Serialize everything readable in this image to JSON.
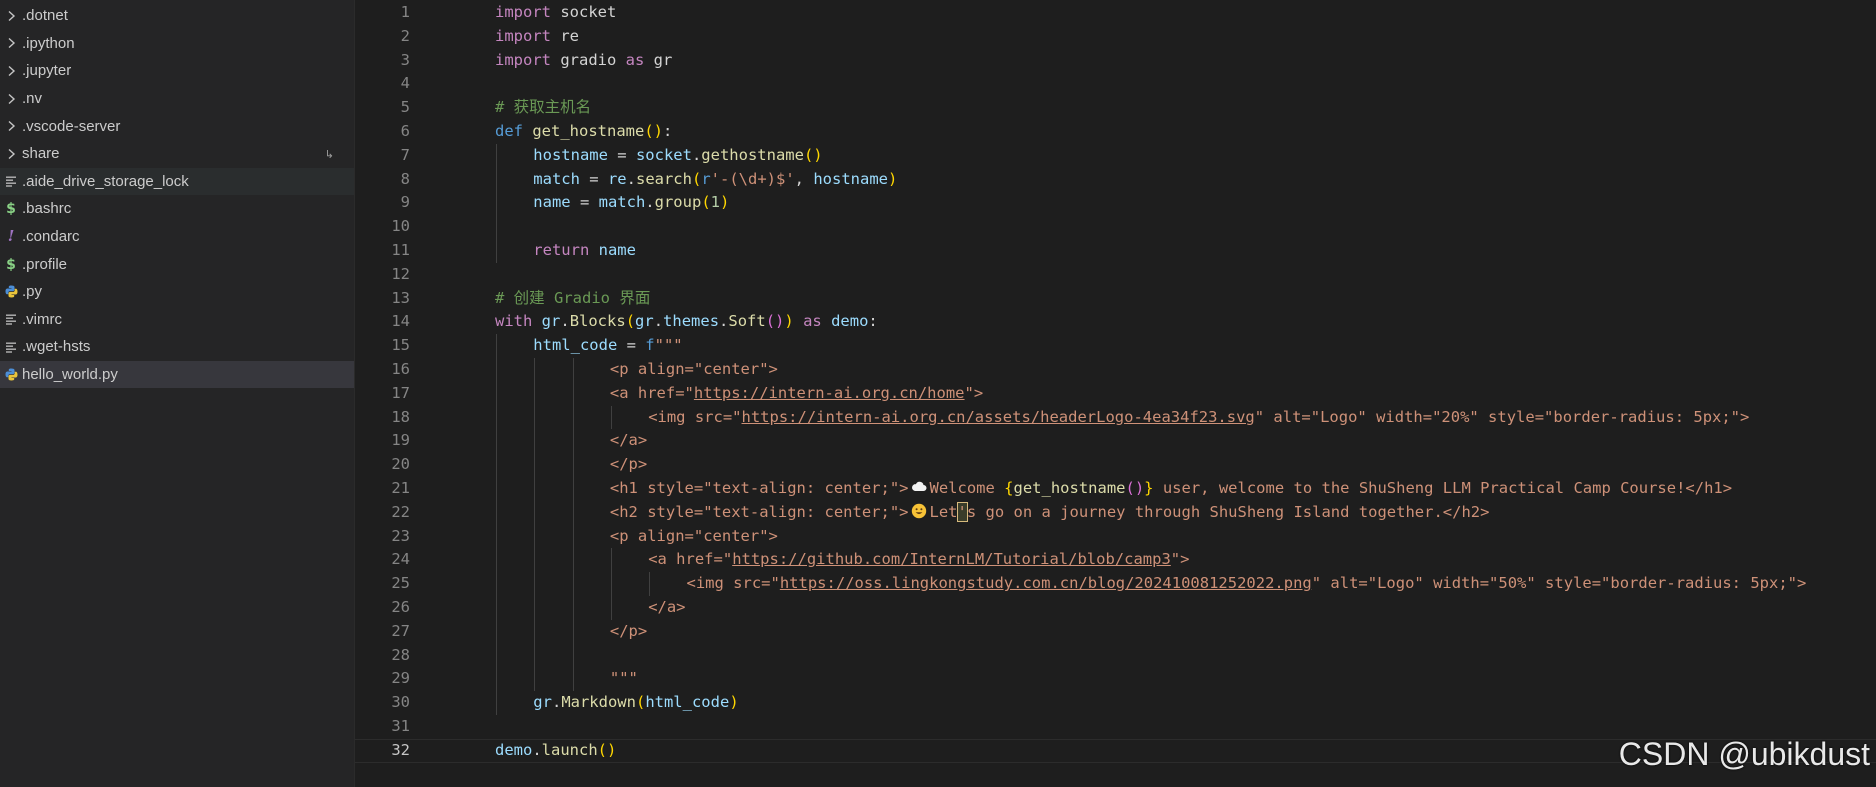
{
  "explorer": {
    "items": [
      {
        "label": ".dotnet",
        "kind": "folder",
        "icon": "chevron-right-icon"
      },
      {
        "label": ".ipython",
        "kind": "folder",
        "icon": "chevron-right-icon"
      },
      {
        "label": ".jupyter",
        "kind": "folder",
        "icon": "chevron-right-icon"
      },
      {
        "label": ".nv",
        "kind": "folder",
        "icon": "chevron-right-icon"
      },
      {
        "label": ".vscode-server",
        "kind": "folder",
        "icon": "chevron-right-icon"
      },
      {
        "label": "share",
        "kind": "folder",
        "icon": "chevron-right-icon",
        "symlink": true
      },
      {
        "label": ".aide_drive_storage_lock",
        "kind": "file",
        "icon": "lines-file-icon",
        "state": "hover"
      },
      {
        "label": ".bashrc",
        "kind": "file",
        "icon": "dollar-icon"
      },
      {
        "label": ".condarc",
        "kind": "file",
        "icon": "exclamation-icon"
      },
      {
        "label": ".profile",
        "kind": "file",
        "icon": "dollar-icon"
      },
      {
        "label": ".py",
        "kind": "file",
        "icon": "python-icon"
      },
      {
        "label": ".vimrc",
        "kind": "file",
        "icon": "lines-file-icon"
      },
      {
        "label": ".wget-hsts",
        "kind": "file",
        "icon": "lines-file-icon"
      },
      {
        "label": "hello_world.py",
        "kind": "file",
        "icon": "python-icon",
        "state": "selected"
      }
    ]
  },
  "editor": {
    "current_line": 32,
    "line_numbers": [
      "1",
      "2",
      "3",
      "4",
      "5",
      "6",
      "7",
      "8",
      "9",
      "10",
      "11",
      "12",
      "13",
      "14",
      "15",
      "16",
      "17",
      "18",
      "19",
      "20",
      "21",
      "22",
      "23",
      "24",
      "25",
      "26",
      "27",
      "28",
      "29",
      "30",
      "31",
      "32"
    ],
    "lines": [
      [
        [
          "kw",
          "import"
        ],
        [
          "",
          "socket"
        ]
      ],
      [
        [
          "kw",
          "import"
        ],
        [
          "",
          "re"
        ]
      ],
      [
        [
          "kw",
          "import"
        ],
        [
          "",
          "gradio "
        ],
        [
          "kw",
          "as"
        ],
        [
          "",
          " gr"
        ]
      ],
      [],
      [
        [
          "cm",
          "# 获取主机名"
        ]
      ],
      [
        [
          "kd",
          "def"
        ],
        [
          "",
          " "
        ],
        [
          "fn",
          "get_hostname"
        ],
        [
          "b1",
          "()"
        ],
        [
          "",
          ":"
        ]
      ],
      [
        [
          "",
          ""
        ],
        [
          "var",
          "hostname"
        ],
        [
          "",
          " = "
        ],
        [
          "var",
          "socket"
        ],
        [
          "",
          "."
        ],
        [
          "fn",
          "gethostname"
        ],
        [
          "b1",
          "()"
        ]
      ],
      [
        [
          "",
          ""
        ],
        [
          "var",
          "match"
        ],
        [
          "",
          " = "
        ],
        [
          "var",
          "re"
        ],
        [
          "",
          "."
        ],
        [
          "fn",
          "search"
        ],
        [
          "b1",
          "("
        ],
        [
          "kd",
          "r"
        ],
        [
          "st",
          "'-(\\d+)$'"
        ],
        [
          "",
          ", "
        ],
        [
          "var",
          "hostname"
        ],
        [
          "b1",
          ")"
        ]
      ],
      [
        [
          "",
          ""
        ],
        [
          "var",
          "name"
        ],
        [
          "",
          " = "
        ],
        [
          "var",
          "match"
        ],
        [
          "",
          "."
        ],
        [
          "fn",
          "group"
        ],
        [
          "b1",
          "("
        ],
        [
          "num",
          "1"
        ],
        [
          "b1",
          ")"
        ]
      ],
      [],
      [
        [
          "",
          ""
        ],
        [
          "kw",
          "return"
        ],
        [
          "",
          " "
        ],
        [
          "var",
          "name"
        ]
      ],
      [],
      [
        [
          "cm",
          "# 创建 Gradio 界面"
        ]
      ],
      [
        [
          "kw",
          "with"
        ],
        [
          "",
          " "
        ],
        [
          "var",
          "gr"
        ],
        [
          "",
          "."
        ],
        [
          "fn",
          "Blocks"
        ],
        [
          "b1",
          "("
        ],
        [
          "var",
          "gr"
        ],
        [
          "",
          "."
        ],
        [
          "var",
          "themes"
        ],
        [
          "",
          "."
        ],
        [
          "fn",
          "Soft"
        ],
        [
          "b2",
          "()"
        ],
        [
          "b1",
          ")"
        ],
        [
          "",
          " "
        ],
        [
          "kw",
          "as"
        ],
        [
          "",
          " "
        ],
        [
          "var",
          "demo"
        ],
        [
          "",
          ":"
        ]
      ],
      [
        [
          "",
          ""
        ],
        [
          "var",
          "html_code"
        ],
        [
          "",
          " = "
        ],
        [
          "kd",
          "f"
        ],
        [
          "st",
          "\"\"\""
        ]
      ],
      [
        [
          "st",
          "<p align=\"center\">"
        ]
      ],
      [
        [
          "st",
          "<a href=\""
        ],
        [
          "st ul",
          "https://intern-ai.org.cn/home"
        ],
        [
          "st",
          "\">"
        ]
      ],
      [
        [
          "st",
          "<img src=\""
        ],
        [
          "st ul",
          "https://intern-ai.org.cn/assets/headerLogo-4ea34f23.svg"
        ],
        [
          "st",
          "\" alt=\"Logo\" width=\"20%\" style=\"border-radius: 5px;\">"
        ]
      ],
      [
        [
          "st",
          "</a>"
        ]
      ],
      [
        [
          "st",
          "</p>"
        ]
      ],
      [
        [
          "st",
          "<h1 style=\"text-align: center;\">"
        ],
        [
          "emoji",
          "cloud"
        ],
        [
          "st",
          "Welcome "
        ],
        [
          "b1",
          "{"
        ],
        [
          "fn",
          "get_hostname"
        ],
        [
          "b2",
          "()"
        ],
        [
          "b1",
          "}"
        ],
        [
          "st",
          " user, welcome to the ShuSheng LLM Practical Camp Course!</h1>"
        ]
      ],
      [
        [
          "st",
          "<h2 style=\"text-align: center;\">"
        ],
        [
          "emoji",
          "smile"
        ],
        [
          "st",
          "Let"
        ],
        [
          "st hl",
          "'"
        ],
        [
          "st",
          "s go on a journey through ShuSheng Island together.</h2>"
        ]
      ],
      [
        [
          "st",
          "<p align=\"center\">"
        ]
      ],
      [
        [
          "st",
          "<a href=\""
        ],
        [
          "st ul",
          "https://github.com/InternLM/Tutorial/blob/camp3"
        ],
        [
          "st",
          "\">"
        ]
      ],
      [
        [
          "st",
          "<img src=\""
        ],
        [
          "st ul",
          "https://oss.lingkongstudy.com.cn/blog/202410081252022.png"
        ],
        [
          "st",
          "\" alt=\"Logo\" width=\"50%\" style=\"border-radius: 5px;\">"
        ]
      ],
      [
        [
          "st",
          "</a>"
        ]
      ],
      [
        [
          "st",
          "</p>"
        ]
      ],
      [],
      [
        [
          "st",
          "\"\"\""
        ]
      ],
      [
        [
          "",
          ""
        ],
        [
          "var",
          "gr"
        ],
        [
          "",
          "."
        ],
        [
          "fn",
          "Markdown"
        ],
        [
          "b1",
          "("
        ],
        [
          "var",
          "html_code"
        ],
        [
          "b1",
          ")"
        ]
      ],
      [],
      [
        [
          "var",
          "demo"
        ],
        [
          "",
          "."
        ],
        [
          "fn",
          "launch"
        ],
        [
          "b1",
          "()"
        ]
      ]
    ],
    "indents": [
      0,
      0,
      0,
      0,
      0,
      0,
      1,
      1,
      1,
      0,
      1,
      0,
      0,
      0,
      1,
      3,
      3,
      4,
      3,
      3,
      3,
      3,
      3,
      4,
      5,
      4,
      3,
      0,
      3,
      1,
      0,
      0
    ],
    "guides": [
      [],
      [],
      [],
      [],
      [],
      [],
      [
        0
      ],
      [
        0
      ],
      [
        0
      ],
      [
        0
      ],
      [
        0
      ],
      [],
      [],
      [],
      [
        0
      ],
      [
        0,
        1,
        2
      ],
      [
        0,
        1,
        2
      ],
      [
        0,
        1,
        2,
        3
      ],
      [
        0,
        1,
        2
      ],
      [
        0,
        1,
        2
      ],
      [
        0,
        1,
        2
      ],
      [
        0,
        1,
        2
      ],
      [
        0,
        1,
        2
      ],
      [
        0,
        1,
        2,
        3
      ],
      [
        0,
        1,
        2,
        3,
        4
      ],
      [
        0,
        1,
        2,
        3
      ],
      [
        0,
        1,
        2
      ],
      [
        0,
        1,
        2
      ],
      [
        0,
        1,
        2
      ],
      [
        0
      ],
      [],
      []
    ]
  },
  "watermark": "CSDN @ubikdust"
}
